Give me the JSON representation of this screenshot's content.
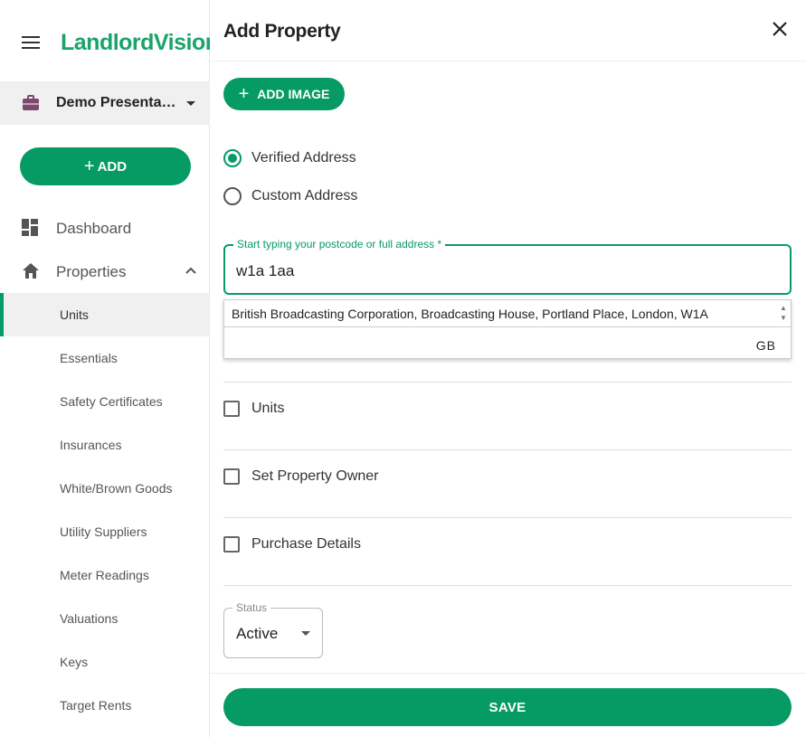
{
  "brand": {
    "logo_text": "LandlordVision",
    "accent": "#069b65"
  },
  "sidebar": {
    "organisation": "Demo Presentation",
    "add_label": "ADD",
    "items": [
      {
        "label": "Dashboard",
        "icon": "dashboard-icon"
      },
      {
        "label": "Properties",
        "icon": "home-icon",
        "expanded": true
      }
    ],
    "sub_items": [
      {
        "label": "Units",
        "active": true
      },
      {
        "label": "Essentials"
      },
      {
        "label": "Safety Certificates"
      },
      {
        "label": "Insurances"
      },
      {
        "label": "White/Brown Goods"
      },
      {
        "label": "Utility Suppliers"
      },
      {
        "label": "Meter Readings"
      },
      {
        "label": "Valuations"
      },
      {
        "label": "Keys"
      },
      {
        "label": "Target Rents"
      }
    ]
  },
  "dialog": {
    "title": "Add Property",
    "add_image_label": "ADD IMAGE",
    "address_options": [
      {
        "label": "Verified Address",
        "checked": true
      },
      {
        "label": "Custom Address",
        "checked": false
      }
    ],
    "search": {
      "label": "Start typing your postcode or full address *",
      "value": "w1a 1aa"
    },
    "suggestion": "British Broadcasting Corporation, Broadcasting House, Portland Place, London, W1A",
    "country": "GB",
    "sections": [
      {
        "label": "Units",
        "checked": false
      },
      {
        "label": "Set Property Owner",
        "checked": false
      },
      {
        "label": "Purchase Details",
        "checked": false
      }
    ],
    "status": {
      "label": "Status",
      "value": "Active"
    },
    "save_label": "SAVE"
  }
}
